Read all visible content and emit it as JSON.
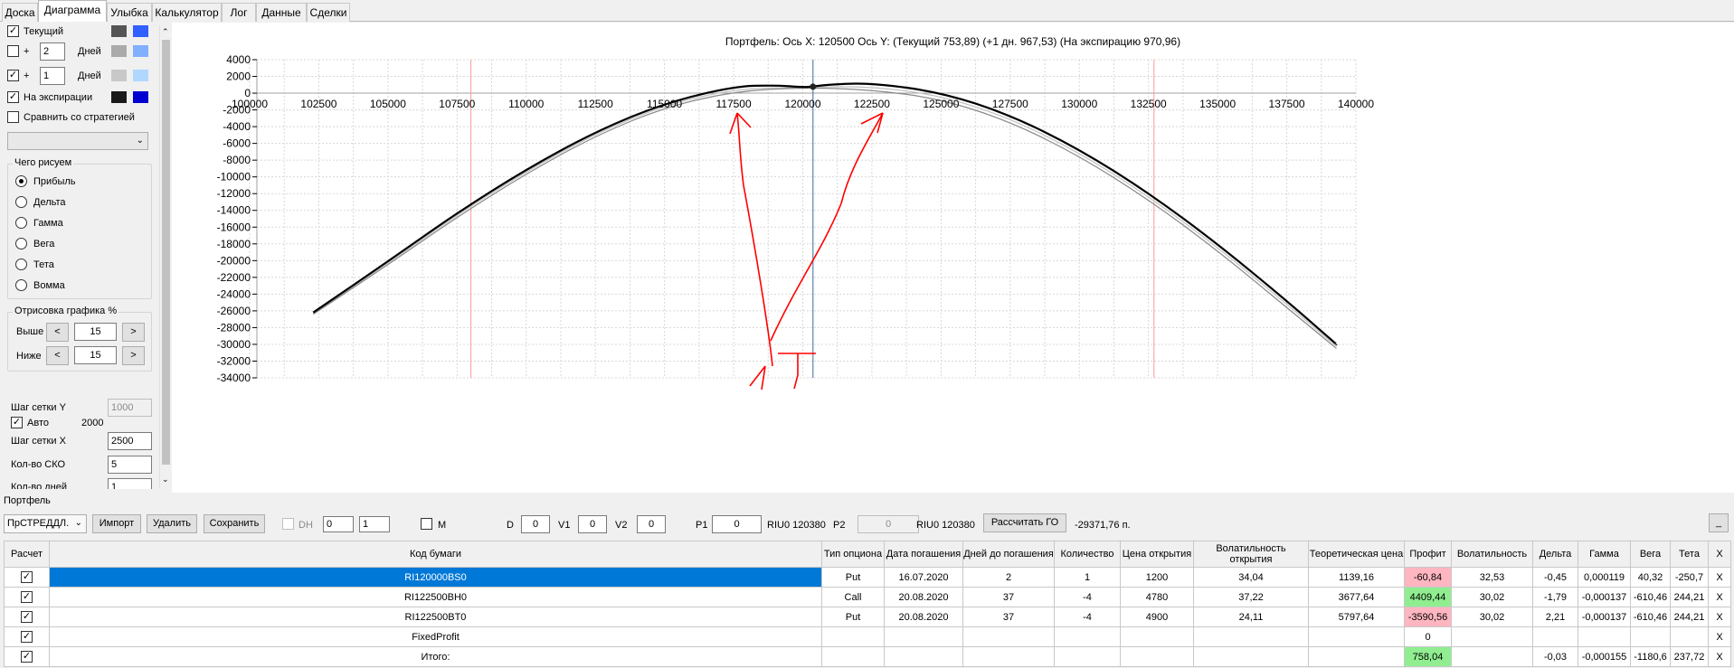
{
  "tabs": [
    "Доска",
    "Диаграмма",
    "Улыбка",
    "Калькулятор",
    "Лог",
    "Данные",
    "Сделки"
  ],
  "active_tab": "Диаграмма",
  "left_panel": {
    "current_label": "Текущий",
    "days_label": "Дней",
    "plus": "+",
    "days_value_1": "2",
    "days_value_2": "1",
    "expiry_label": "На экспирации",
    "compare_label": "Сравнить со стратегией",
    "what_draw_title": "Чего рисуем",
    "radios": [
      "Прибыль",
      "Дельта",
      "Гамма",
      "Вега",
      "Тета",
      "Вомма"
    ],
    "selected_radio": "Прибыль",
    "render_title": "Отрисовка графика %",
    "above_label": "Выше",
    "above_value": "15",
    "below_label": "Ниже",
    "below_value": "15",
    "prev": "<",
    "next": ">",
    "grid_y_label": "Шаг сетки Y",
    "grid_y_value": "1000",
    "auto_label": "Авто",
    "auto_value": "2000",
    "grid_x_label": "Шаг сетки X",
    "grid_x_value": "2500",
    "sko_label": "Кол-во СКО",
    "sko_value": "5",
    "days_count_label": "Кол-во дней",
    "days_count_value": "1",
    "swatches": [
      "#555555",
      "#3060ff",
      "#aaaaaa",
      "#80b0ff",
      "#c8c8c8",
      "#b0d8ff",
      "#1a1a1a",
      "#0000d0"
    ]
  },
  "chart_title": "Портфель: Ось X: 120500 Ось Y:  (Текущий 753,89)  (+1 дн. 967,53)  (На экспирацию 970,96)",
  "chart_data": {
    "type": "line",
    "xlim": [
      100000,
      140000
    ],
    "ylim": [
      -34000,
      4000
    ],
    "x_ticks": [
      100000,
      102500,
      105000,
      107500,
      110000,
      112500,
      115000,
      117500,
      120000,
      122500,
      125000,
      127500,
      130000,
      132500,
      135000,
      137500,
      140000
    ],
    "y_ticks": [
      4000,
      2000,
      0,
      -2000,
      -4000,
      -6000,
      -8000,
      -10000,
      -12000,
      -14000,
      -16000,
      -18000,
      -20000,
      -22000,
      -24000,
      -26000,
      -28000,
      -30000,
      -32000,
      -34000
    ],
    "grid": true,
    "marker_x": 120370,
    "marker_y": 770,
    "vertical_lines": [
      {
        "x": 108000,
        "color": "#ff9a9a"
      },
      {
        "x": 120370,
        "color": "#3a6a9a"
      },
      {
        "x": 132700,
        "color": "#ff9a9a"
      }
    ],
    "series": [
      {
        "color": "#000000",
        "width": 2.2,
        "points": [
          [
            102300,
            -26200
          ],
          [
            105000,
            -20100
          ],
          [
            107500,
            -14300
          ],
          [
            110000,
            -9100
          ],
          [
            112500,
            -4600
          ],
          [
            115000,
            -1200
          ],
          [
            117500,
            800
          ],
          [
            119000,
            950
          ],
          [
            120000,
            700
          ],
          [
            120400,
            800
          ],
          [
            121000,
            1050
          ],
          [
            122500,
            1200
          ],
          [
            125000,
            100
          ],
          [
            127500,
            -2600
          ],
          [
            130000,
            -6700
          ],
          [
            132500,
            -11900
          ],
          [
            135000,
            -18000
          ],
          [
            137500,
            -24800
          ],
          [
            139300,
            -30000
          ]
        ]
      },
      {
        "color": "#888888",
        "width": 1.2,
        "points": [
          [
            102300,
            -26400
          ],
          [
            105000,
            -20500
          ],
          [
            107500,
            -14800
          ],
          [
            110000,
            -9600
          ],
          [
            112500,
            -5100
          ],
          [
            115000,
            -1700
          ],
          [
            117500,
            200
          ],
          [
            120000,
            700
          ],
          [
            122500,
            400
          ],
          [
            125000,
            -700
          ],
          [
            127500,
            -3400
          ],
          [
            130000,
            -7500
          ],
          [
            132500,
            -12700
          ],
          [
            135000,
            -18800
          ],
          [
            137500,
            -25600
          ],
          [
            139300,
            -30500
          ]
        ]
      },
      {
        "color": "#c0c0c0",
        "width": 1.2,
        "points": [
          [
            102300,
            -26300
          ],
          [
            105000,
            -20300
          ],
          [
            107500,
            -14550
          ],
          [
            110000,
            -9350
          ],
          [
            112500,
            -4850
          ],
          [
            115000,
            -1450
          ],
          [
            117500,
            500
          ],
          [
            120000,
            720
          ],
          [
            122500,
            800
          ],
          [
            125000,
            -300
          ],
          [
            127500,
            -3000
          ],
          [
            130000,
            -7100
          ],
          [
            132500,
            -12300
          ],
          [
            135000,
            -18400
          ],
          [
            137500,
            -25200
          ],
          [
            139300,
            -30250
          ]
        ]
      }
    ]
  },
  "portfolio": {
    "group_label": "Портфель",
    "select_value": "ПрСТРЕДДЛ.",
    "import_btn": "Импорт",
    "delete_btn": "Удалить",
    "save_btn": "Сохранить",
    "dh_label": "DH",
    "dh_val1": "0",
    "dh_val2": "1",
    "m_label": "M",
    "d_label": "D",
    "d_value": "0",
    "v1_label": "V1",
    "v1_value": "0",
    "v2_label": "V2",
    "v2_value": "0",
    "p1_label": "P1",
    "p1_value": "0",
    "riu1": "RIU0 120380",
    "p2_label": "P2",
    "p2_value": "0",
    "riu2": "RIU0 120380",
    "calc_btn": "Рассчитать ГО",
    "total_go": "-29371,76 п.",
    "minimize": "_"
  },
  "table": {
    "headers": [
      "Расчет",
      "Код бумаги",
      "Тип опциона",
      "Дата погашения",
      "Дней до погашения",
      "Количество",
      "Цена открытия",
      "Волатильность открытия",
      "Теоретическая цена",
      "Профит",
      "Волатильность",
      "Дельта",
      "Гамма",
      "Вега",
      "Тета",
      "X"
    ],
    "rows": [
      {
        "code": "RI120000BS0",
        "type": "Put",
        "date": "16.07.2020",
        "days": "2",
        "qty": "1",
        "open_price": "1200",
        "open_vol": "34,04",
        "theo": "1139,16",
        "profit": "-60,84",
        "profit_kind": "neg",
        "vol": "32,53",
        "delta": "-0,45",
        "gamma": "0,000119",
        "vega": "40,32",
        "theta": "-250,7",
        "x": "X",
        "selected": true
      },
      {
        "code": "RI122500BH0",
        "type": "Call",
        "date": "20.08.2020",
        "days": "37",
        "qty": "-4",
        "open_price": "4780",
        "open_vol": "37,22",
        "theo": "3677,64",
        "profit": "4409,44",
        "profit_kind": "pos",
        "vol": "30,02",
        "delta": "-1,79",
        "gamma": "-0,000137",
        "vega": "-610,46",
        "theta": "244,21",
        "x": "X"
      },
      {
        "code": "RI122500BT0",
        "type": "Put",
        "date": "20.08.2020",
        "days": "37",
        "qty": "-4",
        "open_price": "4900",
        "open_vol": "24,11",
        "theo": "5797,64",
        "profit": "-3590,56",
        "profit_kind": "neg",
        "vol": "30,02",
        "delta": "2,21",
        "gamma": "-0,000137",
        "vega": "-610,46",
        "theta": "244,21",
        "x": "X"
      },
      {
        "code": "FixedProfit",
        "type": "",
        "date": "",
        "days": "",
        "qty": "",
        "open_price": "",
        "open_vol": "",
        "theo": "",
        "profit": "0",
        "profit_kind": "",
        "vol": "",
        "delta": "",
        "gamma": "",
        "vega": "",
        "theta": "",
        "x": "X"
      },
      {
        "code": "Итого:",
        "type": "",
        "date": "",
        "days": "",
        "qty": "",
        "open_price": "",
        "open_vol": "",
        "theo": "",
        "profit": "758,04",
        "profit_kind": "pos",
        "vol": "",
        "delta": "-0,03",
        "gamma": "-0,000155",
        "vega": "-1180,6",
        "theta": "237,72",
        "x": "X"
      }
    ]
  }
}
